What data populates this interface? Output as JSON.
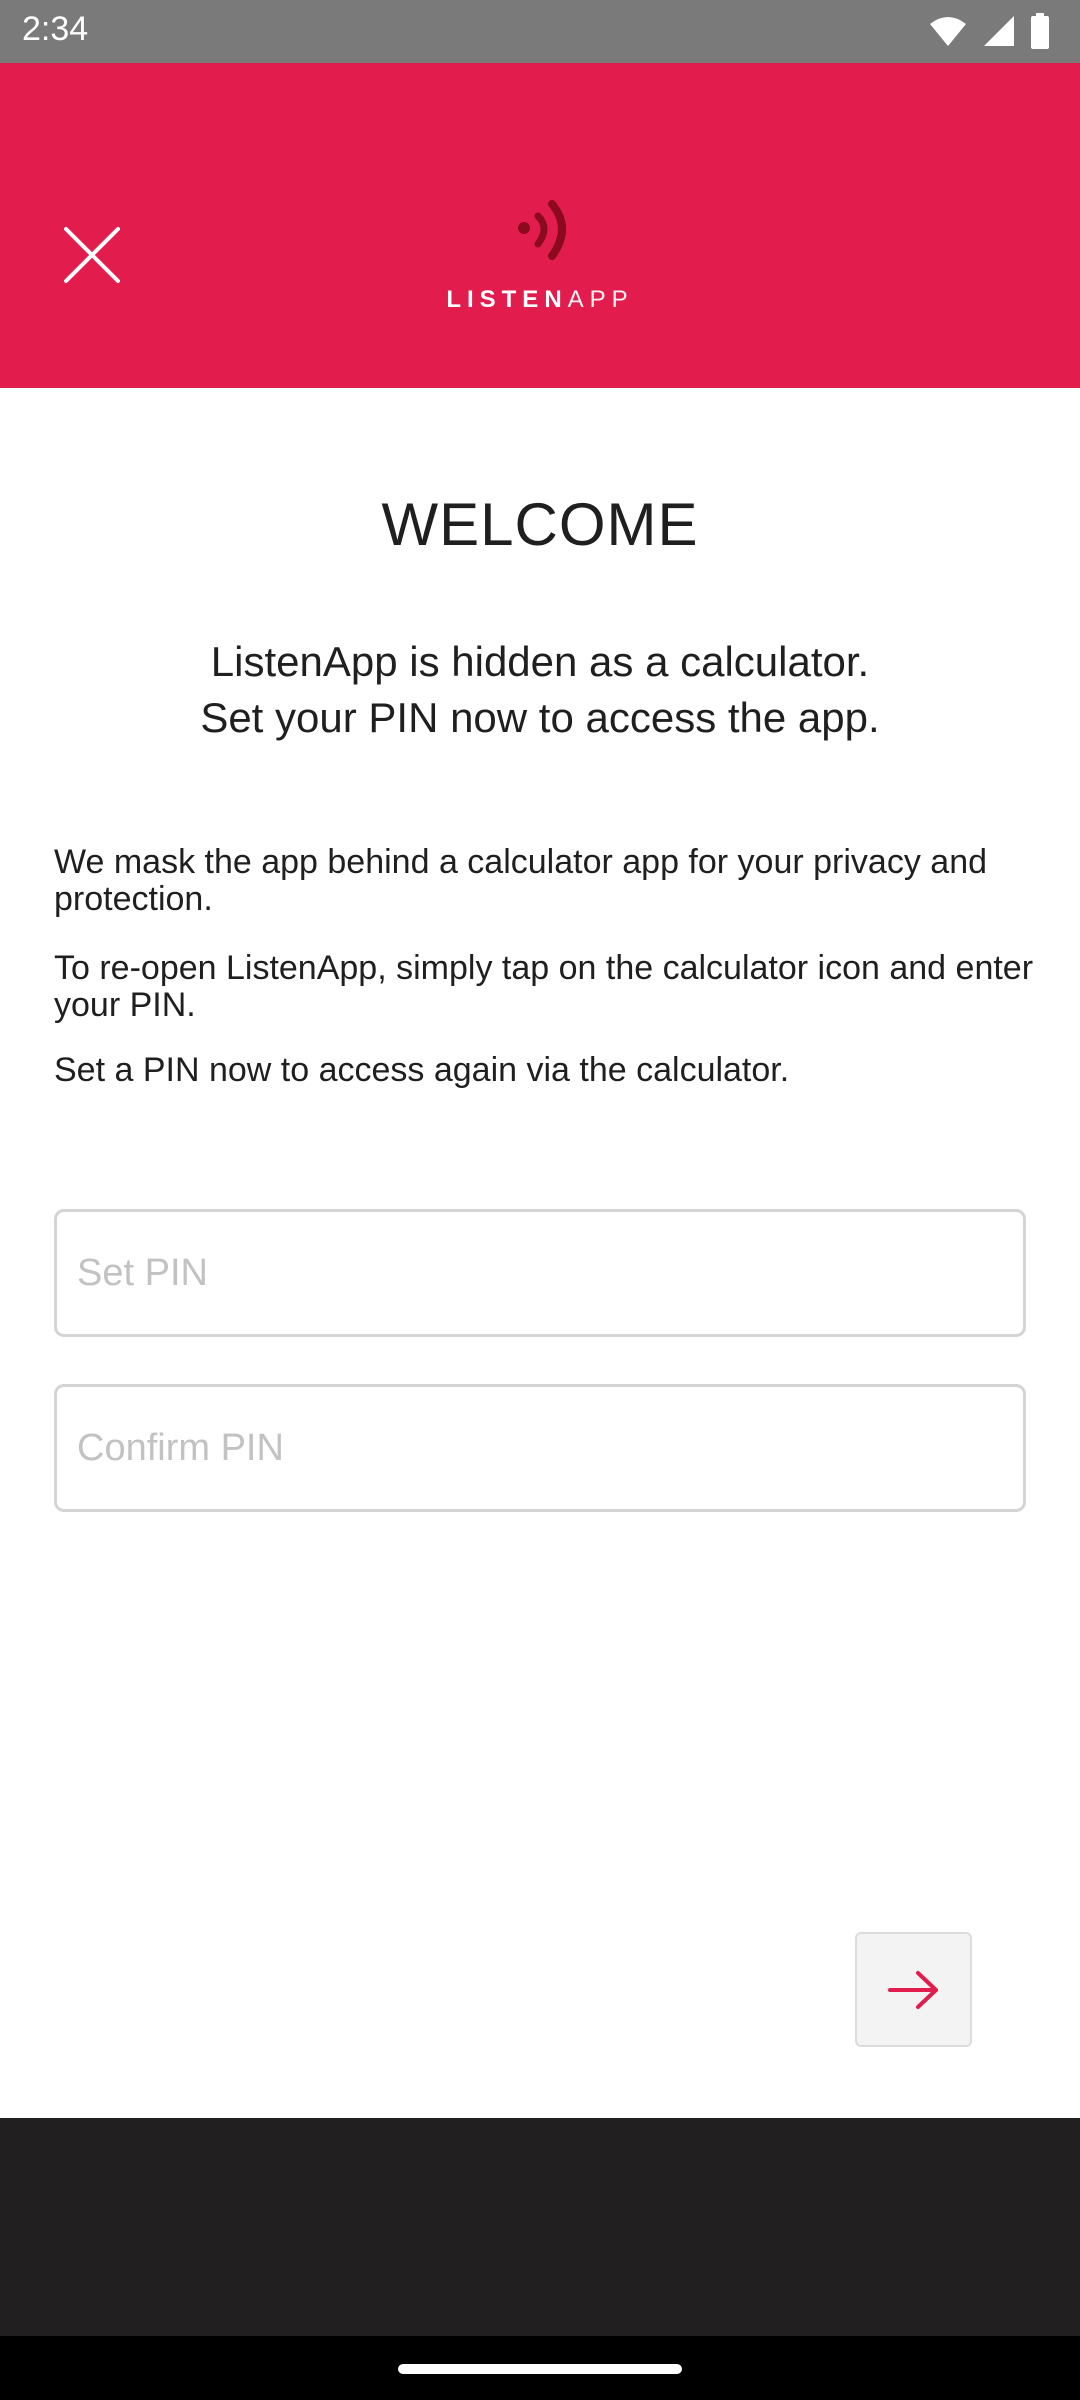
{
  "status_bar": {
    "time": "2:34",
    "icons": [
      "wifi-icon",
      "cellular-signal-icon",
      "battery-icon"
    ]
  },
  "header": {
    "brand_color": "#e21d4d",
    "logo_text_bold": "LISTEN",
    "logo_text_light": "APP",
    "close_icon": "close-icon"
  },
  "content": {
    "title": "WELCOME",
    "subtitle_line1": "ListenApp is hidden as a calculator.",
    "subtitle_line2": "Set your PIN now to access the app.",
    "paragraph1": "We mask the app behind a calculator app for your privacy and protection.",
    "paragraph2": "To re-open ListenApp, simply tap on the calculator icon and enter your PIN.",
    "paragraph3": "Set a PIN now to access again via the calculator."
  },
  "form": {
    "set_pin_placeholder": "Set PIN",
    "set_pin_value": "",
    "confirm_pin_placeholder": "Confirm PIN",
    "confirm_pin_value": ""
  },
  "actions": {
    "next_icon": "arrow-right-icon",
    "accent_color": "#e21d4d"
  }
}
